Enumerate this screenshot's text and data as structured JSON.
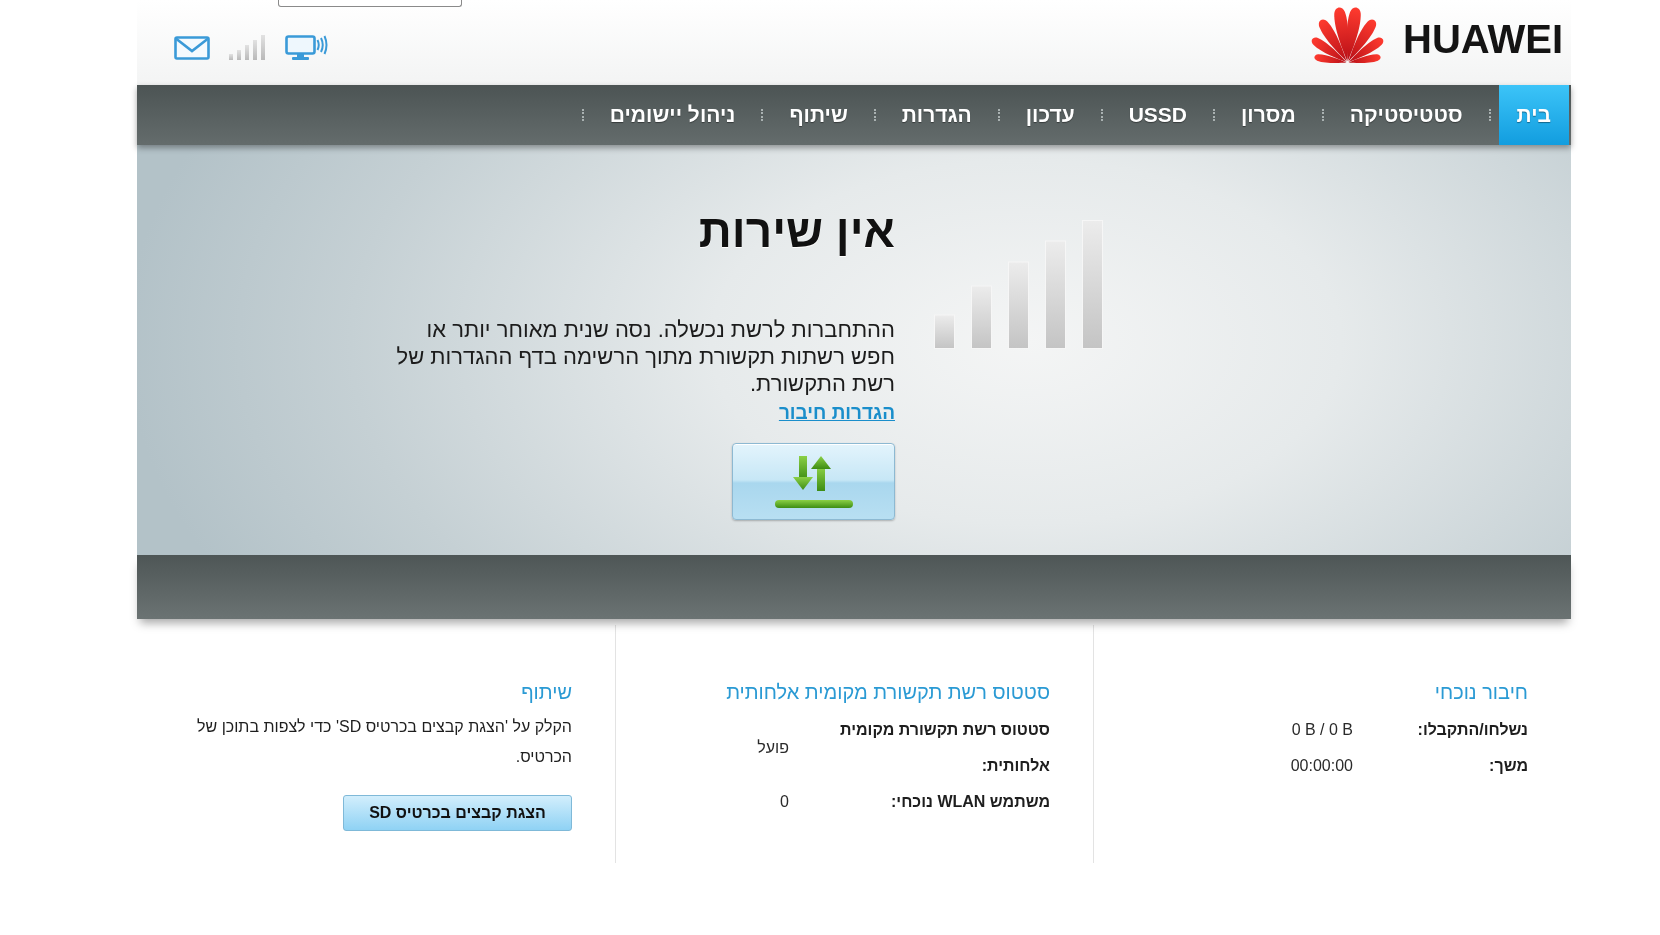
{
  "header": {
    "logo_text": "HUAWEI"
  },
  "nav": {
    "tabs": [
      {
        "label": "בית",
        "selected": true
      },
      {
        "label": "סטטיסטיקה",
        "selected": false
      },
      {
        "label": "מסרון",
        "selected": false
      },
      {
        "label": "USSD",
        "selected": false
      },
      {
        "label": "עדכון",
        "selected": false
      },
      {
        "label": "הגדרות",
        "selected": false
      },
      {
        "label": "שיתוף",
        "selected": false
      },
      {
        "label": "ניהול יישומים",
        "selected": false
      }
    ]
  },
  "hero": {
    "title": "אין שירות",
    "message": "ההתחברות לרשת נכשלה. נסה שנית מאוחר יותר או חפש רשתות תקשורת מתוך הרשימה בדף ההגדרות של רשת התקשורת.",
    "link": "הגדרות חיבור"
  },
  "panels": [
    {
      "kind": "stats",
      "title": "חיבור נוכחי",
      "rows": [
        {
          "label": "נשלחו/התקבלו:",
          "value": "0 B / 0 B"
        },
        {
          "label": "משך:",
          "value": "00:00:00"
        }
      ]
    },
    {
      "kind": "stats",
      "title": "סטטוס רשת תקשורת מקומית אלחותית",
      "rows": [
        {
          "label": "סטטוס רשת תקשורת מקומית אלחותית:",
          "value": "פועל"
        },
        {
          "label": "משתמש WLAN נוכחי:",
          "value": "0"
        }
      ]
    },
    {
      "kind": "action",
      "title": "שיתוף",
      "text": "הקלק על 'הצגת קבצים בכרטיס SD' כדי לצפות בתוכן של הכרטיס.",
      "button": "הצגת קבצים בכרטיס SD"
    }
  ]
}
